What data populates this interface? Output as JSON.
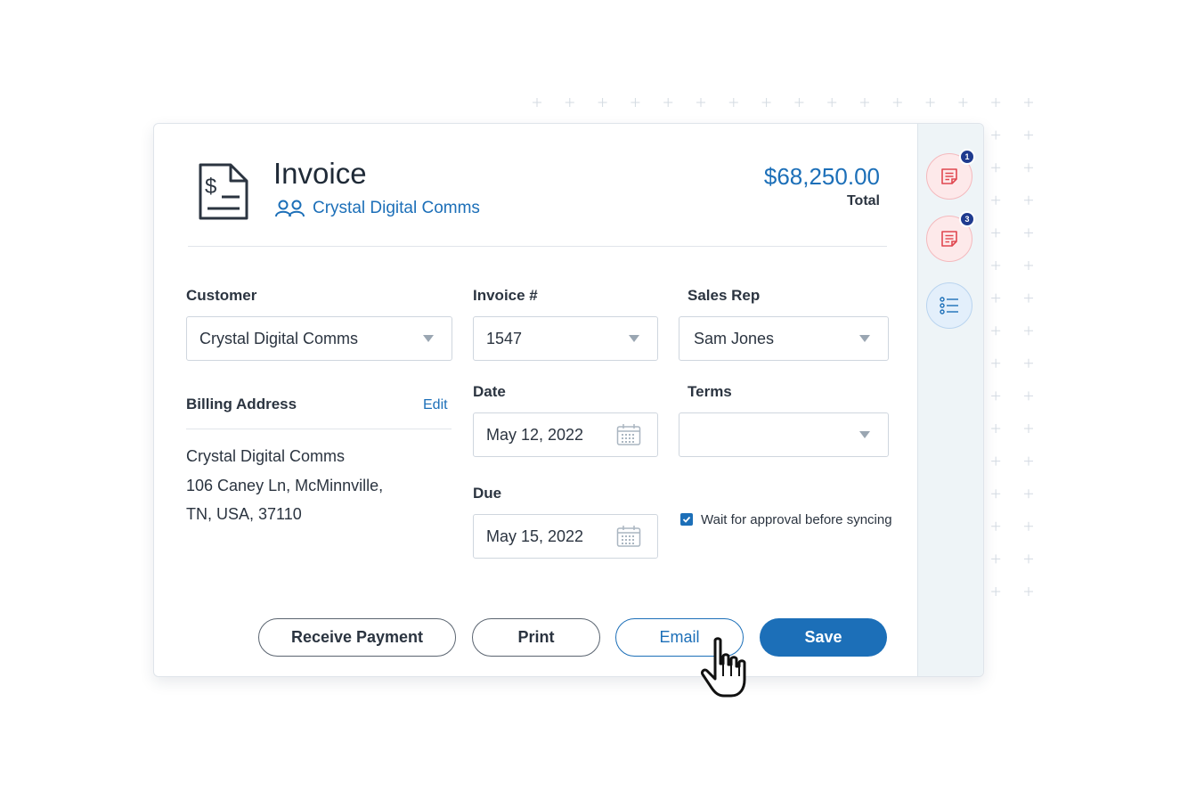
{
  "invoice": {
    "title": "Invoice",
    "customer_link": "Crystal Digital Comms",
    "total_amount": "$68,250.00",
    "total_label": "Total"
  },
  "form": {
    "customer": {
      "label": "Customer",
      "value": "Crystal Digital Comms"
    },
    "invoice_number": {
      "label": "Invoice #",
      "value": "1547"
    },
    "sales_rep": {
      "label": "Sales Rep",
      "value": "Sam Jones"
    },
    "date": {
      "label": "Date",
      "value": "May 12, 2022"
    },
    "terms": {
      "label": "Terms",
      "value": ""
    },
    "due": {
      "label": "Due",
      "value": "May 15, 2022"
    },
    "approval_checkbox": {
      "label": "Wait for approval before syncing",
      "checked": true
    }
  },
  "billing": {
    "label": "Billing Address",
    "edit_label": "Edit",
    "lines": [
      "Crystal Digital Comms",
      "106 Caney Ln, McMinnville,",
      "TN, USA, 37110"
    ]
  },
  "actions": {
    "receive_payment": "Receive Payment",
    "print": "Print",
    "email": "Email",
    "save": "Save"
  },
  "side_rail": {
    "items": [
      {
        "icon": "note-icon",
        "badge": "1",
        "color": "#fde9ea"
      },
      {
        "icon": "note-icon",
        "badge": "3",
        "color": "#fde9ea"
      },
      {
        "icon": "list-icon",
        "badge": "",
        "color": "#e3effb"
      }
    ]
  },
  "colors": {
    "accent": "#1c6fb8",
    "badge": "#1f3b8f"
  }
}
